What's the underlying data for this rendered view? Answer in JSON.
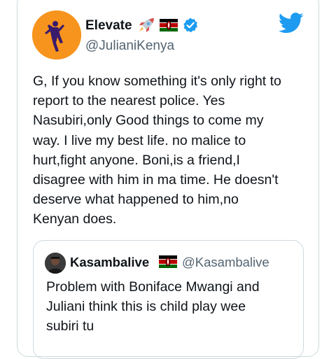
{
  "tweet": {
    "display_name": "Elevate",
    "handle": "@JulianiKenya",
    "name_icons": [
      "rocket-emoji",
      "kenya-flag",
      "verified-badge"
    ],
    "text": "G, If you know something it's only right to\nreport to the nearest police. Yes\nNasubiri,only Good things to come my\nway. I live my best life. no malice to\nhurt,fight anyone. Boni,is a friend,I\ndisagree with him in ma time. He doesn't\ndeserve what happened to him,no\nKenyan does."
  },
  "quoted": {
    "display_name": "Kasambalive",
    "handle": "@Kasambalive",
    "name_icons": [
      "kenya-flag"
    ],
    "text": "Problem with Boniface Mwangi and\nJuliani think this is child play  wee\nsubiri tu"
  },
  "colors": {
    "accent": "#1d9bf0",
    "avatar_bg": "#f7941d",
    "text": "#0f1419",
    "secondary": "#536471",
    "border": "#cfd9de"
  }
}
